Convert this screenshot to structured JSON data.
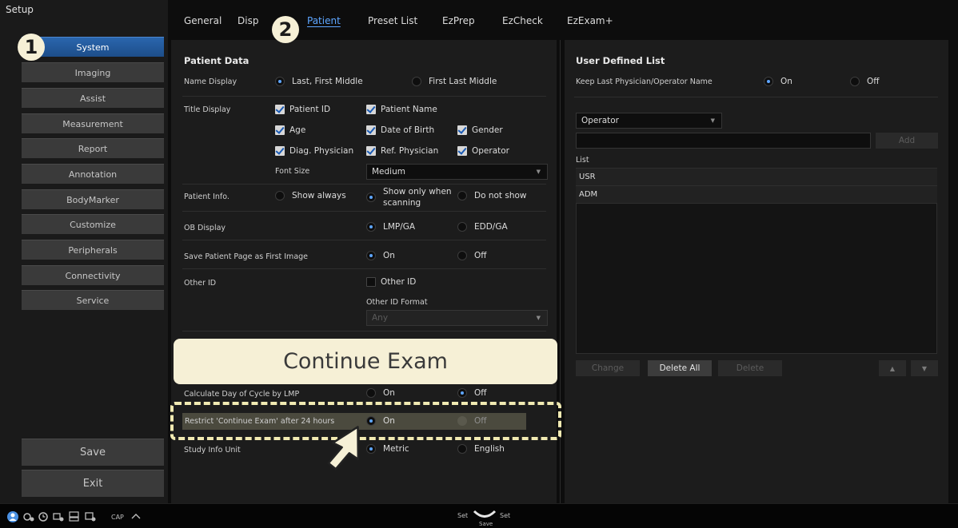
{
  "sidebar": {
    "title": "Setup",
    "items": [
      {
        "label": "System"
      },
      {
        "label": "Imaging"
      },
      {
        "label": "Assist"
      },
      {
        "label": "Measurement"
      },
      {
        "label": "Report"
      },
      {
        "label": "Annotation"
      },
      {
        "label": "BodyMarker"
      },
      {
        "label": "Customize"
      },
      {
        "label": "Peripherals"
      },
      {
        "label": "Connectivity"
      },
      {
        "label": "Service"
      }
    ],
    "save_label": "Save",
    "exit_label": "Exit"
  },
  "tabs": [
    {
      "label": "General"
    },
    {
      "label": "Disp"
    },
    {
      "label": "Patient"
    },
    {
      "label": "Preset List"
    },
    {
      "label": "EzPrep"
    },
    {
      "label": "EzCheck"
    },
    {
      "label": "EzExam+"
    }
  ],
  "badges": {
    "one": "1",
    "two": "2"
  },
  "patient_data": {
    "heading": "Patient Data",
    "name_display": {
      "label": "Name Display",
      "opt1": "Last, First Middle",
      "opt2": "First Last Middle"
    },
    "title_display": {
      "label": "Title Display",
      "patient_id": "Patient ID",
      "patient_name": "Patient Name",
      "age": "Age",
      "dob": "Date of Birth",
      "gender": "Gender",
      "diag_physician": "Diag. Physician",
      "ref_physician": "Ref. Physician",
      "operator": "Operator",
      "font_size_label": "Font Size",
      "font_size_value": "Medium"
    },
    "patient_info": {
      "label": "Patient Info.",
      "opt1": "Show always",
      "opt2_line1": "Show only when",
      "opt2_line2": "scanning",
      "opt3": "Do not show"
    },
    "ob_display": {
      "label": "OB Display",
      "opt1": "LMP/GA",
      "opt2": "EDD/GA"
    },
    "save_first": {
      "label": "Save Patient Page as First Image",
      "opt1": "On",
      "opt2": "Off"
    },
    "other_id": {
      "label": "Other ID",
      "check_label": "Other ID",
      "format_label": "Other ID Format",
      "format_value": "Any"
    },
    "calc_day": {
      "label": "Calculate Day of Cycle by LMP",
      "opt1": "On",
      "opt2": "Off"
    },
    "restrict": {
      "label": "Restrict 'Continue Exam' after 24 hours",
      "opt1": "On",
      "opt2": "Off"
    },
    "study_unit": {
      "label": "Study Info Unit",
      "opt1": "Metric",
      "opt2": "English"
    }
  },
  "banner": {
    "text": "Continue Exam"
  },
  "user_list": {
    "heading": "User Defined List",
    "keep_label": "Keep Last Physician/Operator Name",
    "keep_on": "On",
    "keep_off": "Off",
    "category_value": "Operator",
    "add_label": "Add",
    "list_label": "List",
    "rows": [
      {
        "text": "USR"
      },
      {
        "text": "ADM"
      }
    ],
    "change_label": "Change",
    "delete_all_label": "Delete All",
    "delete_label": "Delete",
    "up_label": "▲",
    "down_label": "▼"
  },
  "status": {
    "cap": "CAP",
    "set_left": "Set",
    "set_right": "Set",
    "save_small": "Save"
  },
  "colors": {
    "accent": "#5ea6ff",
    "active_side": "#2a66ad",
    "banner": "#f6f0d6"
  }
}
